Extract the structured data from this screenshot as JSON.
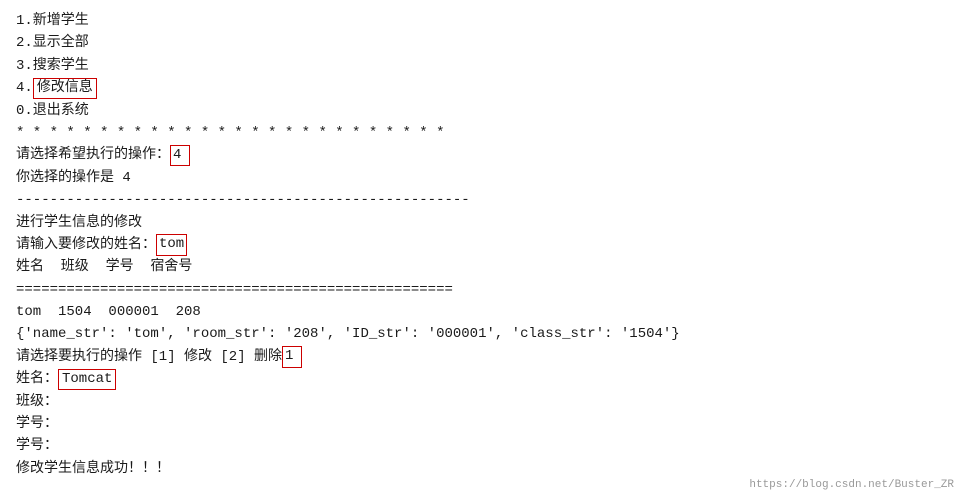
{
  "terminal": {
    "menu": {
      "item1": "1.新增学生",
      "item2": "2.显示全部",
      "item3": "3.搜索学生",
      "item4_prefix": "4.",
      "item4_highlighted": "修改信息",
      "item0": "0.退出系统",
      "separator_stars": "* * * * * * * * * * * * * * * * * * * * * * * * * *"
    },
    "interaction1": {
      "prompt": "请选择希望执行的操作：",
      "input_value": "4",
      "response": "你选择的操作是 4"
    },
    "separator_dashes": "------------------------------------------------------",
    "section1": {
      "title": "进行学生信息的修改",
      "name_prompt": "请输入要修改的姓名：",
      "name_input": "tom",
      "headers": "姓名  班级  学号  宿舍号"
    },
    "separator_equals": "====================================================",
    "data_row": "tom  1504  000001  208",
    "dict_row": "{'name_str': 'tom', 'room_str': '208', 'ID_str': '000001', 'class_str': '1504'}",
    "action_prompt": "请选择要执行的操作 [1] 修改 [2] 删除",
    "action_input": "1",
    "fields": {
      "name_label": "姓名：",
      "name_value": "Tomcat",
      "class_label": "班级：",
      "class_value": "",
      "id1_label": "学号：",
      "id1_value": "",
      "id2_label": "学号：",
      "id2_value": "",
      "success": "修改学生信息成功！！！"
    },
    "watermark": "https://blog.csdn.net/Buster_ZR"
  }
}
